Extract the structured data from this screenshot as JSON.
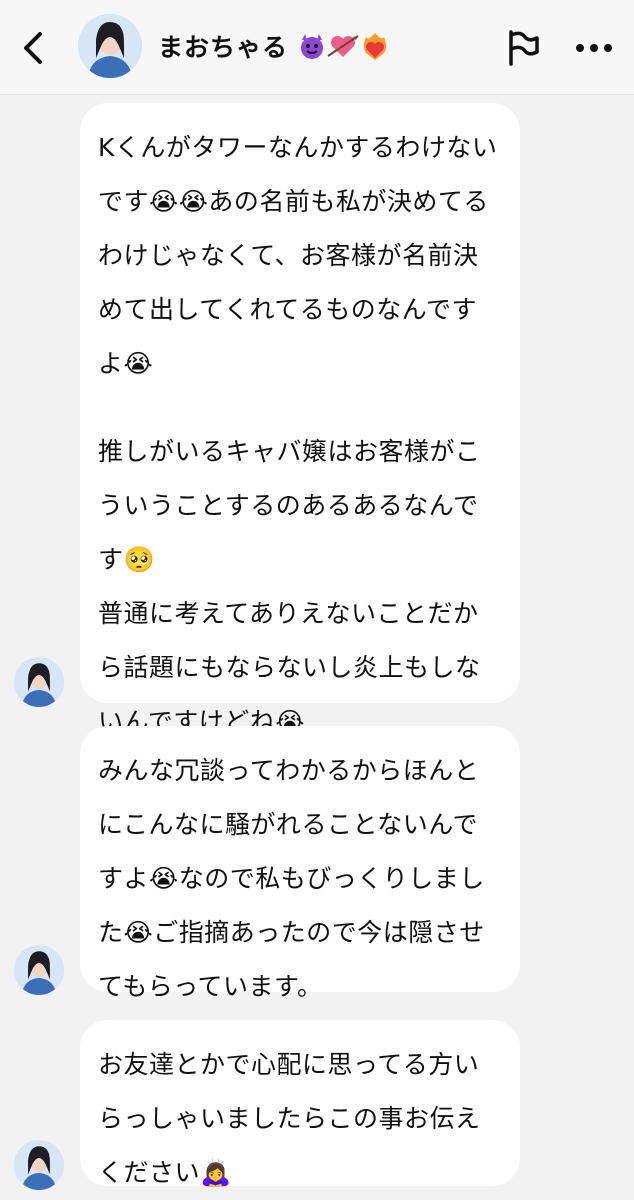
{
  "header": {
    "name": "まおちゃる",
    "name_emojis": [
      "smiling-imp-icon",
      "heart-with-arrow-icon",
      "heart-on-fire-icon"
    ]
  },
  "messages": [
    {
      "lines": [
        "Kくんがタワーなんかするわけない",
        "です😭😭あの名前も私が決めてる",
        "わけじゃなくて、お客様が名前決",
        "めて出してくれてるものなんです",
        "よ😭",
        "",
        "推しがいるキャバ嬢はお客様がこ",
        "ういうことするのあるあるなんで",
        "す🥺",
        "普通に考えてありえないことだか",
        "ら話題にもならないし炎上もしな",
        "いんですけどね😭"
      ]
    },
    {
      "lines": [
        "みんな冗談ってわかるからほんと",
        "にこんなに騒がれることないんで",
        "すよ😭なので私もびっくりしまし",
        "た😭ご指摘あったので今は隠させ",
        "てもらっています。"
      ]
    },
    {
      "lines": [
        "お友達とかで心配に思ってる方い",
        "らっしゃいましたらこの事お伝え",
        "ください🙇‍♀️"
      ]
    }
  ],
  "colors": {
    "background": "#f2f2f3",
    "bubble": "#ffffff",
    "text": "#111111",
    "avatar_bg": "#cfe0f5"
  }
}
